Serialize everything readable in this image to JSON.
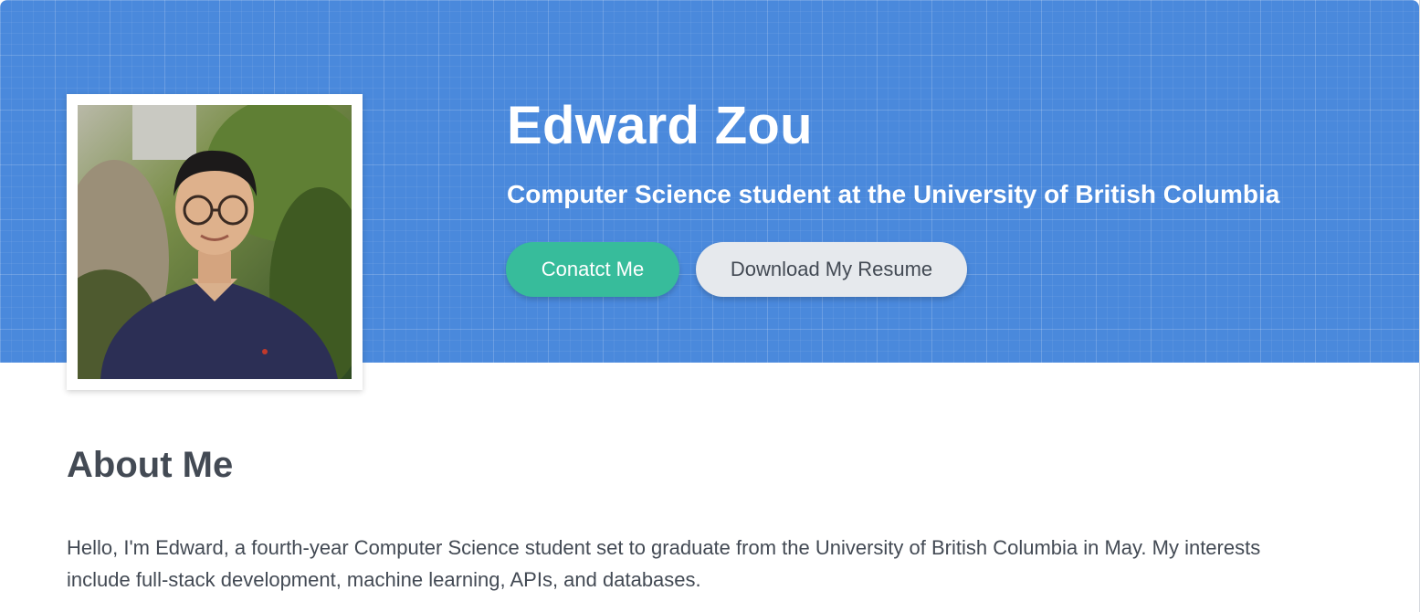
{
  "header": {
    "name": "Edward Zou",
    "subtitle": "Computer Science student at the University of British Columbia",
    "contact_button": "Conatct Me",
    "resume_button": "Download My Resume",
    "accent_color": "#4a89dc",
    "contact_color": "#37bc9b"
  },
  "profile_photo": {
    "icon": "profile-photo"
  },
  "about": {
    "title": "About Me",
    "text": "Hello, I'm Edward, a fourth-year Computer Science student set to graduate from the University of British Columbia in May. My interests include full-stack development, machine learning, APIs, and databases."
  }
}
